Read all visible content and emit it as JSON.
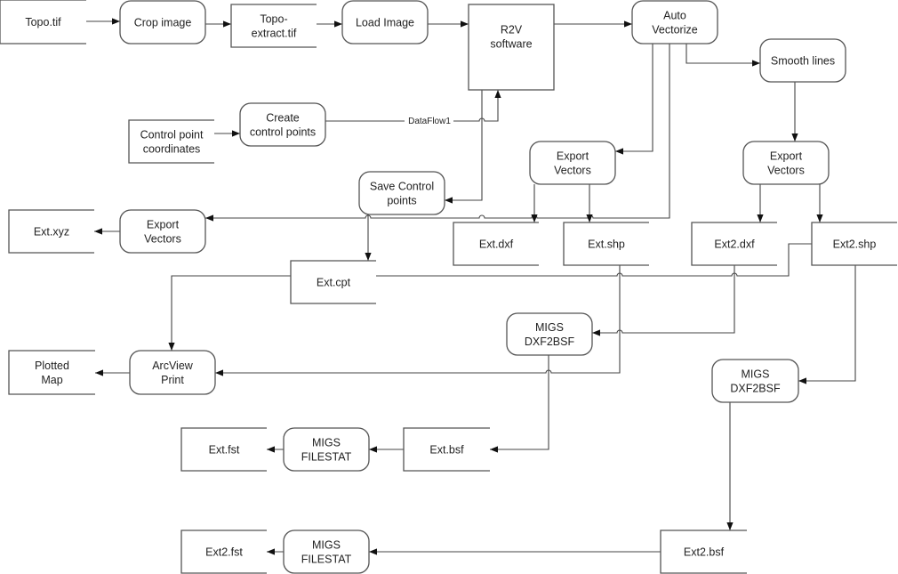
{
  "nodes": {
    "topo_tif": {
      "type": "store",
      "lines": [
        "Topo.tif"
      ]
    },
    "crop_image": {
      "type": "process",
      "lines": [
        "Crop image"
      ]
    },
    "topo_extract": {
      "type": "store",
      "lines": [
        "Topo-",
        "extract.tif"
      ]
    },
    "load_image": {
      "type": "process",
      "lines": [
        "Load Image"
      ]
    },
    "r2v": {
      "type": "entity",
      "lines": [
        "R2V",
        "software"
      ]
    },
    "auto_vectorize": {
      "type": "process",
      "lines": [
        "Auto",
        "Vectorize"
      ]
    },
    "smooth_lines": {
      "type": "process",
      "lines": [
        "Smooth lines"
      ]
    },
    "control_coords": {
      "type": "store",
      "lines": [
        "Control point",
        "coordinates"
      ]
    },
    "create_cp": {
      "type": "process",
      "lines": [
        "Create",
        "control points"
      ]
    },
    "save_cp": {
      "type": "process",
      "lines": [
        "Save Control",
        "points"
      ]
    },
    "export_left": {
      "type": "process",
      "lines": [
        "Export",
        "Vectors"
      ]
    },
    "ext_xyz": {
      "type": "store",
      "lines": [
        "Ext.xyz"
      ]
    },
    "ext_cpt": {
      "type": "store",
      "lines": [
        "Ext.cpt"
      ]
    },
    "export_mid": {
      "type": "process",
      "lines": [
        "Export",
        "Vectors"
      ]
    },
    "export_right": {
      "type": "process",
      "lines": [
        "Export",
        "Vectors"
      ]
    },
    "ext_dxf": {
      "type": "store",
      "lines": [
        "Ext.dxf"
      ]
    },
    "ext_shp": {
      "type": "store",
      "lines": [
        "Ext.shp"
      ]
    },
    "ext2_dxf": {
      "type": "store",
      "lines": [
        "Ext2.dxf"
      ]
    },
    "ext2_shp": {
      "type": "store",
      "lines": [
        "Ext2.shp"
      ]
    },
    "migs_dxf2bsf_1": {
      "type": "process",
      "lines": [
        "MIGS",
        "DXF2BSF"
      ]
    },
    "arcview": {
      "type": "process",
      "lines": [
        "ArcView",
        "Print"
      ]
    },
    "plotted_map": {
      "type": "store",
      "lines": [
        "Plotted",
        "Map"
      ]
    },
    "migs_dxf2bsf_2": {
      "type": "process",
      "lines": [
        "MIGS",
        "DXF2BSF"
      ]
    },
    "ext_fst": {
      "type": "store",
      "lines": [
        "Ext.fst"
      ]
    },
    "migs_filestat_1": {
      "type": "process",
      "lines": [
        "MIGS",
        "FILESTAT"
      ]
    },
    "ext_bsf": {
      "type": "store",
      "lines": [
        "Ext.bsf"
      ]
    },
    "ext2_fst": {
      "type": "store",
      "lines": [
        "Ext2.fst"
      ]
    },
    "migs_filestat_2": {
      "type": "process",
      "lines": [
        "MIGS",
        "FILESTAT"
      ]
    },
    "ext2_bsf": {
      "type": "store",
      "lines": [
        "Ext2.bsf"
      ]
    }
  },
  "edge_labels": {
    "dataflow1": "DataFlow1"
  },
  "colors": {
    "stroke": "#555555",
    "background": "#ffffff"
  }
}
